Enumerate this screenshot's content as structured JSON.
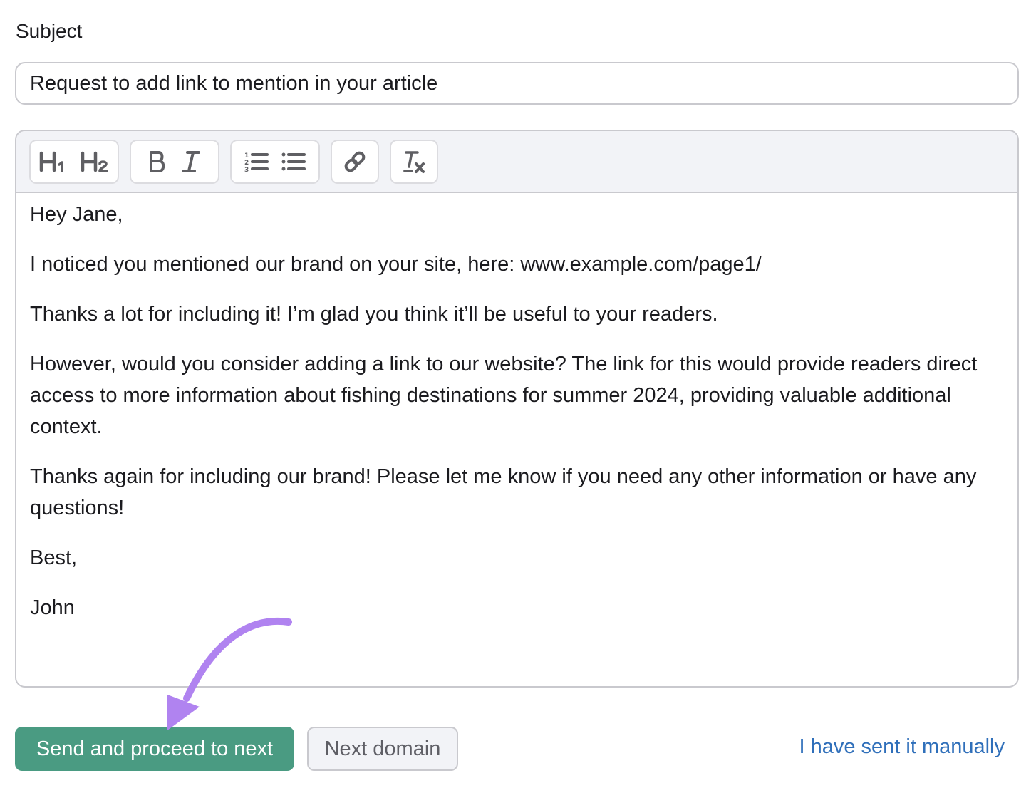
{
  "subject": {
    "label": "Subject",
    "value": "Request to add link to mention in your article"
  },
  "editor": {
    "toolbar": {
      "groups": [
        [
          {
            "icon": "heading-1-icon",
            "label": "H1"
          },
          {
            "icon": "heading-2-icon",
            "label": "H2"
          }
        ],
        [
          {
            "icon": "bold-icon",
            "label": "B"
          },
          {
            "icon": "italic-icon",
            "label": "I"
          }
        ],
        [
          {
            "icon": "ordered-list-icon"
          },
          {
            "icon": "bullet-list-icon"
          }
        ],
        [
          {
            "icon": "link-icon"
          }
        ],
        [
          {
            "icon": "clear-format-icon"
          }
        ]
      ]
    },
    "paragraphs": [
      "Hey Jane,",
      "I noticed you mentioned our brand on your site, here: www.example.com/page1/",
      "Thanks a lot for including it! I’m glad you think it’ll be useful to your readers.",
      "However, would you consider adding a link to our website? The link for this would provide readers direct access to more information about fishing destinations for summer 2024, providing valuable additional context.",
      "Thanks again for including our brand! Please let me know if you need any other information or have any questions!",
      "Best,",
      "John"
    ]
  },
  "actions": {
    "send_label": "Send and proceed to next",
    "next_label": "Next domain",
    "manual_label": "I have sent it manually"
  },
  "annotation": {
    "arrow_color": "#b083f0",
    "points_to": "send-and-proceed-button"
  },
  "colors": {
    "primary": "#4a9b82",
    "link": "#2f6fba",
    "toolbar_bg": "#f2f3f7"
  }
}
